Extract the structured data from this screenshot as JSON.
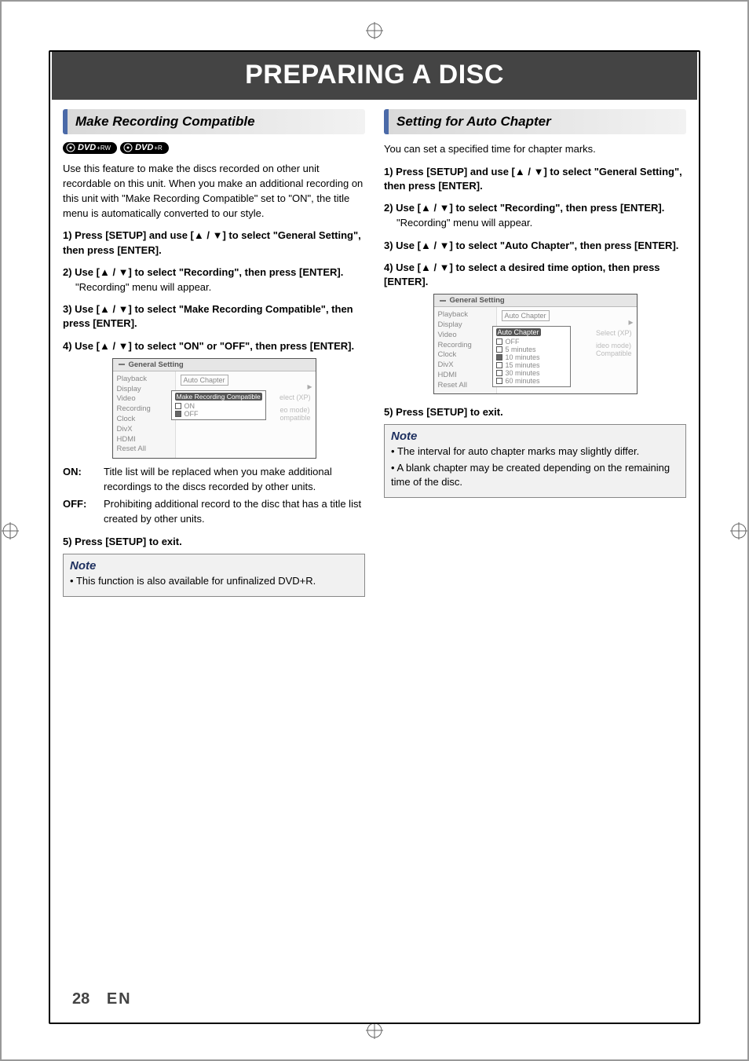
{
  "page_title": "PREPARING A DISC",
  "left": {
    "heading": "Make Recording Compatible",
    "disc_badges": [
      "DVD +RW",
      "DVD +R"
    ],
    "intro": "Use this feature to make the discs recorded on other unit recordable on this unit. When you make an additional recording on this unit with \"Make Recording Compatible\" set to \"ON\", the title menu is automatically converted to our style.",
    "steps": [
      {
        "label": "1) Press [SETUP] and use [▲ / ▼] to select \"General Setting\", then press [ENTER]."
      },
      {
        "label": "2) Use [▲ / ▼] to select \"Recording\", then press [ENTER].",
        "sub": "\"Recording\" menu will appear."
      },
      {
        "label": "3) Use [▲ / ▼] to select \"Make Recording Compatible\", then press [ENTER]."
      },
      {
        "label": "4) Use [▲ / ▼] to select \"ON\" or \"OFF\", then press [ENTER]."
      }
    ],
    "menu": {
      "title": "General Setting",
      "left_items": [
        "Playback",
        "Display",
        "Video",
        "Recording",
        "Clock",
        "DivX",
        "HDMI",
        "Reset All"
      ],
      "right_label": "Auto Chapter",
      "popup_label": "Make Recording Compatible",
      "options": [
        "ON",
        "OFF"
      ],
      "checked": "OFF",
      "ghost1": "elect (XP)",
      "ghost2a": "eo mode)",
      "ghost2b": "ompatible"
    },
    "defs": [
      {
        "term": "ON:",
        "text": "Title list will be replaced when you make additional recordings to the discs recorded by other units."
      },
      {
        "term": "OFF:",
        "text": "Prohibiting additional record to the disc that has a title list created by other units."
      }
    ],
    "step5": "5) Press [SETUP] to exit.",
    "note": {
      "title": "Note",
      "items": [
        "This function is also available for unfinalized DVD+R."
      ]
    }
  },
  "right": {
    "heading": "Setting for Auto Chapter",
    "intro": "You can set a specified time for chapter marks.",
    "steps": [
      {
        "label": "1) Press [SETUP] and use [▲ / ▼] to select \"General Setting\", then press [ENTER]."
      },
      {
        "label": "2) Use [▲ / ▼] to select \"Recording\", then press [ENTER].",
        "sub": "\"Recording\" menu will appear."
      },
      {
        "label": "3) Use [▲ / ▼] to select \"Auto Chapter\", then press [ENTER]."
      },
      {
        "label": "4) Use [▲ / ▼] to select a desired time option, then press [ENTER]."
      }
    ],
    "menu": {
      "title": "General Setting",
      "left_items": [
        "Playback",
        "Display",
        "Video",
        "Recording",
        "Clock",
        "DivX",
        "HDMI",
        "Reset All"
      ],
      "right_label": "Auto Chapter",
      "popup_label": "Auto Chapter",
      "options": [
        "OFF",
        "5 minutes",
        "10 minutes",
        "15 minutes",
        "30 minutes",
        "60 minutes"
      ],
      "checked": "10 minutes",
      "ghost1": "Select (XP)",
      "ghost2a": "ideo mode)",
      "ghost2b": "Compatible"
    },
    "step5": "5) Press [SETUP] to exit.",
    "note": {
      "title": "Note",
      "items": [
        "The interval for auto chapter marks may slightly differ.",
        "A blank chapter may be created depending on the remaining time of the disc."
      ]
    }
  },
  "footer": {
    "page": "28",
    "lang": "EN"
  }
}
